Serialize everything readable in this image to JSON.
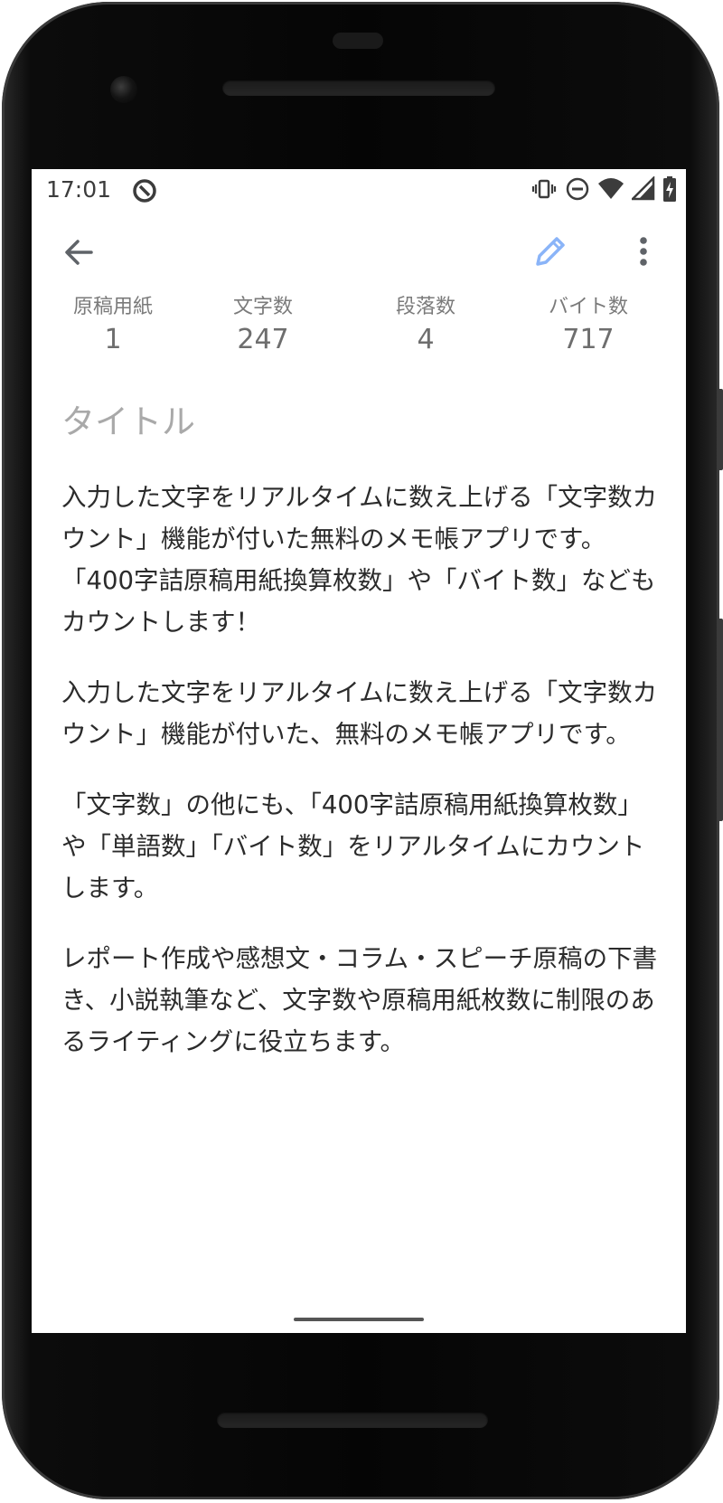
{
  "status_bar": {
    "time": "17:01",
    "icons": [
      "vibrate-icon",
      "do-not-disturb-icon",
      "wifi-icon",
      "signal-icon",
      "battery-charging-icon"
    ]
  },
  "toolbar": {
    "back_icon": "arrow-back-icon",
    "edit_icon": "pencil-icon",
    "more_icon": "more-vert-icon",
    "accent_color": "#8ab4f8"
  },
  "stats": [
    {
      "label": "原稿用紙",
      "value": "1"
    },
    {
      "label": "文字数",
      "value": "247"
    },
    {
      "label": "段落数",
      "value": "4"
    },
    {
      "label": "バイト数",
      "value": "717"
    }
  ],
  "note": {
    "title_placeholder": "タイトル",
    "paragraphs": [
      "入力した文字をリアルタイムに数え上げる「文字数カウント」機能が付いた無料のメモ帳アプリです。「400字詰原稿用紙換算枚数」や「バイト数」などもカウントします！",
      "入力した文字をリアルタイムに数え上げる「文字数カウント」機能が付いた、無料のメモ帳アプリです。",
      "「文字数」の他にも、「400字詰原稿用紙換算枚数」や「単語数」「バイト数」をリアルタイムにカウントします。",
      "レポート作成や感想文・コラム・スピーチ原稿の下書き、小説執筆など、文字数や原稿用紙枚数に制限のあるライティングに役立ちます。"
    ]
  }
}
